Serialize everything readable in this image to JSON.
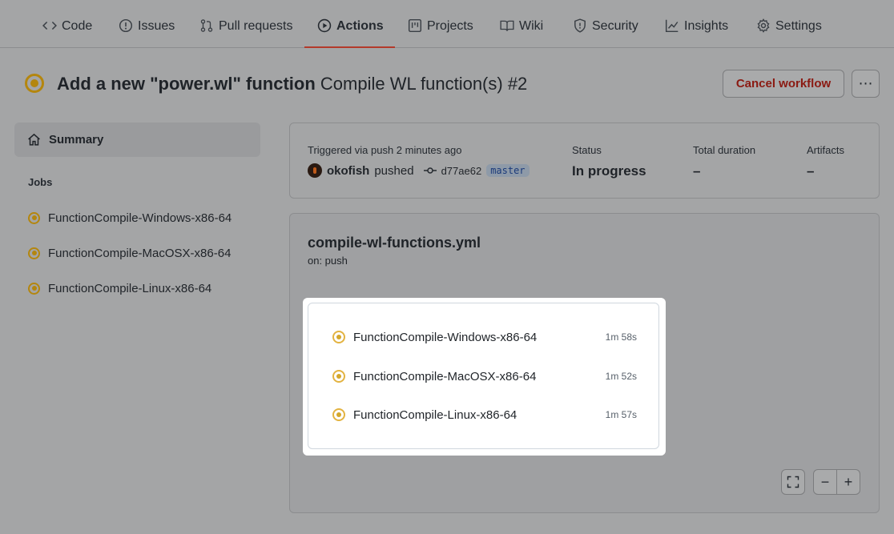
{
  "nav": {
    "tabs": [
      {
        "label": "Code",
        "icon": "code-icon"
      },
      {
        "label": "Issues",
        "icon": "issue-icon"
      },
      {
        "label": "Pull requests",
        "icon": "pull-request-icon"
      },
      {
        "label": "Actions",
        "icon": "play-icon"
      },
      {
        "label": "Projects",
        "icon": "project-icon"
      },
      {
        "label": "Wiki",
        "icon": "book-icon"
      },
      {
        "label": "Security",
        "icon": "shield-icon"
      },
      {
        "label": "Insights",
        "icon": "graph-icon"
      },
      {
        "label": "Settings",
        "icon": "gear-icon"
      }
    ],
    "active_tab": "Actions"
  },
  "run": {
    "commit_message": "Add a new \"power.wl\" function",
    "workflow_run": "Compile WL function(s) #2",
    "cancel_label": "Cancel workflow",
    "more_label": "⋯"
  },
  "sidebar": {
    "summary_label": "Summary",
    "jobs_heading": "Jobs",
    "jobs": [
      {
        "label": "FunctionCompile-Windows-x86-64"
      },
      {
        "label": "FunctionCompile-MacOSX-x86-64"
      },
      {
        "label": "FunctionCompile-Linux-x86-64"
      }
    ]
  },
  "info": {
    "trigger_text": "Triggered via push 2 minutes ago",
    "user": "okofish",
    "action": "pushed",
    "commit_sha": "d77ae62",
    "branch": "master",
    "status_label": "Status",
    "status_value": "In progress",
    "duration_label": "Total duration",
    "duration_value": "–",
    "artifacts_label": "Artifacts",
    "artifacts_value": "–"
  },
  "graph": {
    "workflow_file": "compile-wl-functions.yml",
    "trigger": "on: push",
    "jobs": [
      {
        "label": "FunctionCompile-Windows-x86-64",
        "duration": "1m 58s"
      },
      {
        "label": "FunctionCompile-MacOSX-x86-64",
        "duration": "1m 52s"
      },
      {
        "label": "FunctionCompile-Linux-x86-64",
        "duration": "1m 57s"
      }
    ],
    "zoom_out_label": "−",
    "zoom_in_label": "+"
  },
  "colors": {
    "in_progress": "#d4a72c",
    "cancel_text": "#8b1a12",
    "active_tab_underline": "#b33a2a"
  }
}
